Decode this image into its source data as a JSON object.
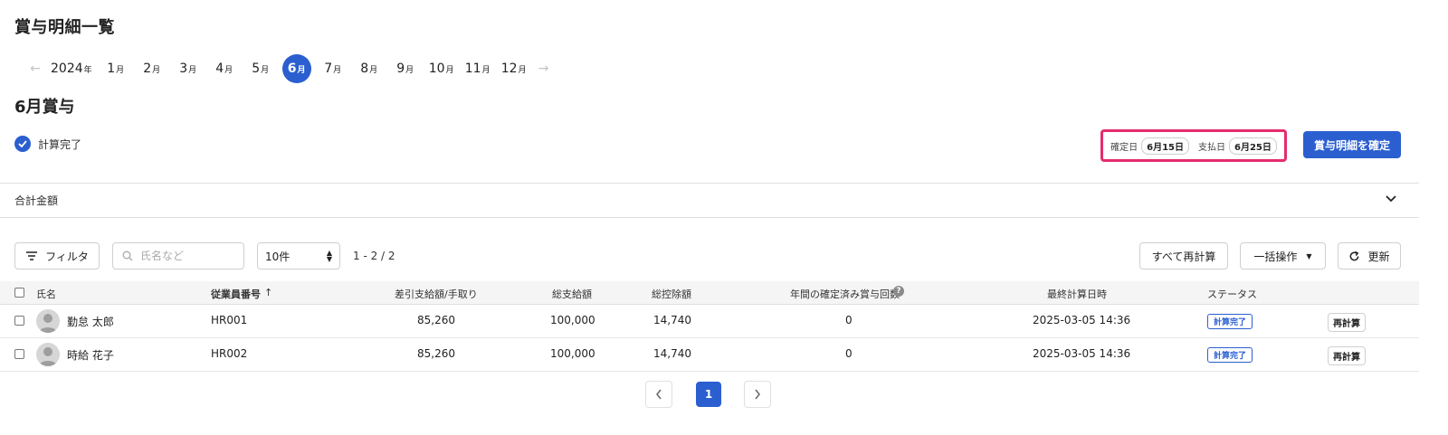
{
  "page": {
    "title": "賞与明細一覧"
  },
  "month_nav": {
    "year": "2024",
    "year_suffix": "年",
    "month_suffix": "月",
    "months": [
      "1",
      "2",
      "3",
      "4",
      "5",
      "6",
      "7",
      "8",
      "9",
      "10",
      "11",
      "12"
    ],
    "selected": "6"
  },
  "bonus": {
    "title": "6月賞与",
    "status": "計算完了",
    "confirm_date_label": "確定日",
    "confirm_date": "6月15日",
    "pay_date_label": "支払日",
    "pay_date": "6月25日",
    "confirm_button": "賞与明細を確定"
  },
  "totals": {
    "label": "合計金額"
  },
  "toolbar": {
    "filter_label": "フィルタ",
    "search_placeholder": "氏名など",
    "per_page": "10件",
    "range": "1 - 2 / 2",
    "recalc_all": "すべて再計算",
    "bulk_action": "一括操作",
    "refresh": "更新"
  },
  "table": {
    "headers": {
      "name": "氏名",
      "employee_no": "従業員番号",
      "net_pay": "差引支給額/手取り",
      "gross": "総支給額",
      "deductions": "総控除額",
      "bonus_count": "年間の確定済み賞与回数",
      "last_calc": "最終計算日時",
      "status": "ステータス"
    },
    "rows": [
      {
        "name": "勤怠 太郎",
        "employee_no": "HR001",
        "net_pay": "85,260",
        "gross": "100,000",
        "deductions": "14,740",
        "bonus_count": "0",
        "last_calc": "2025-03-05 14:36",
        "status": "計算完了",
        "action": "再計算"
      },
      {
        "name": "時給 花子",
        "employee_no": "HR002",
        "net_pay": "85,260",
        "gross": "100,000",
        "deductions": "14,740",
        "bonus_count": "0",
        "last_calc": "2025-03-05 14:36",
        "status": "計算完了",
        "action": "再計算"
      }
    ]
  },
  "pagination": {
    "current": "1"
  },
  "colors": {
    "accent": "#2b5fd0",
    "highlight": "#e62c6e"
  }
}
